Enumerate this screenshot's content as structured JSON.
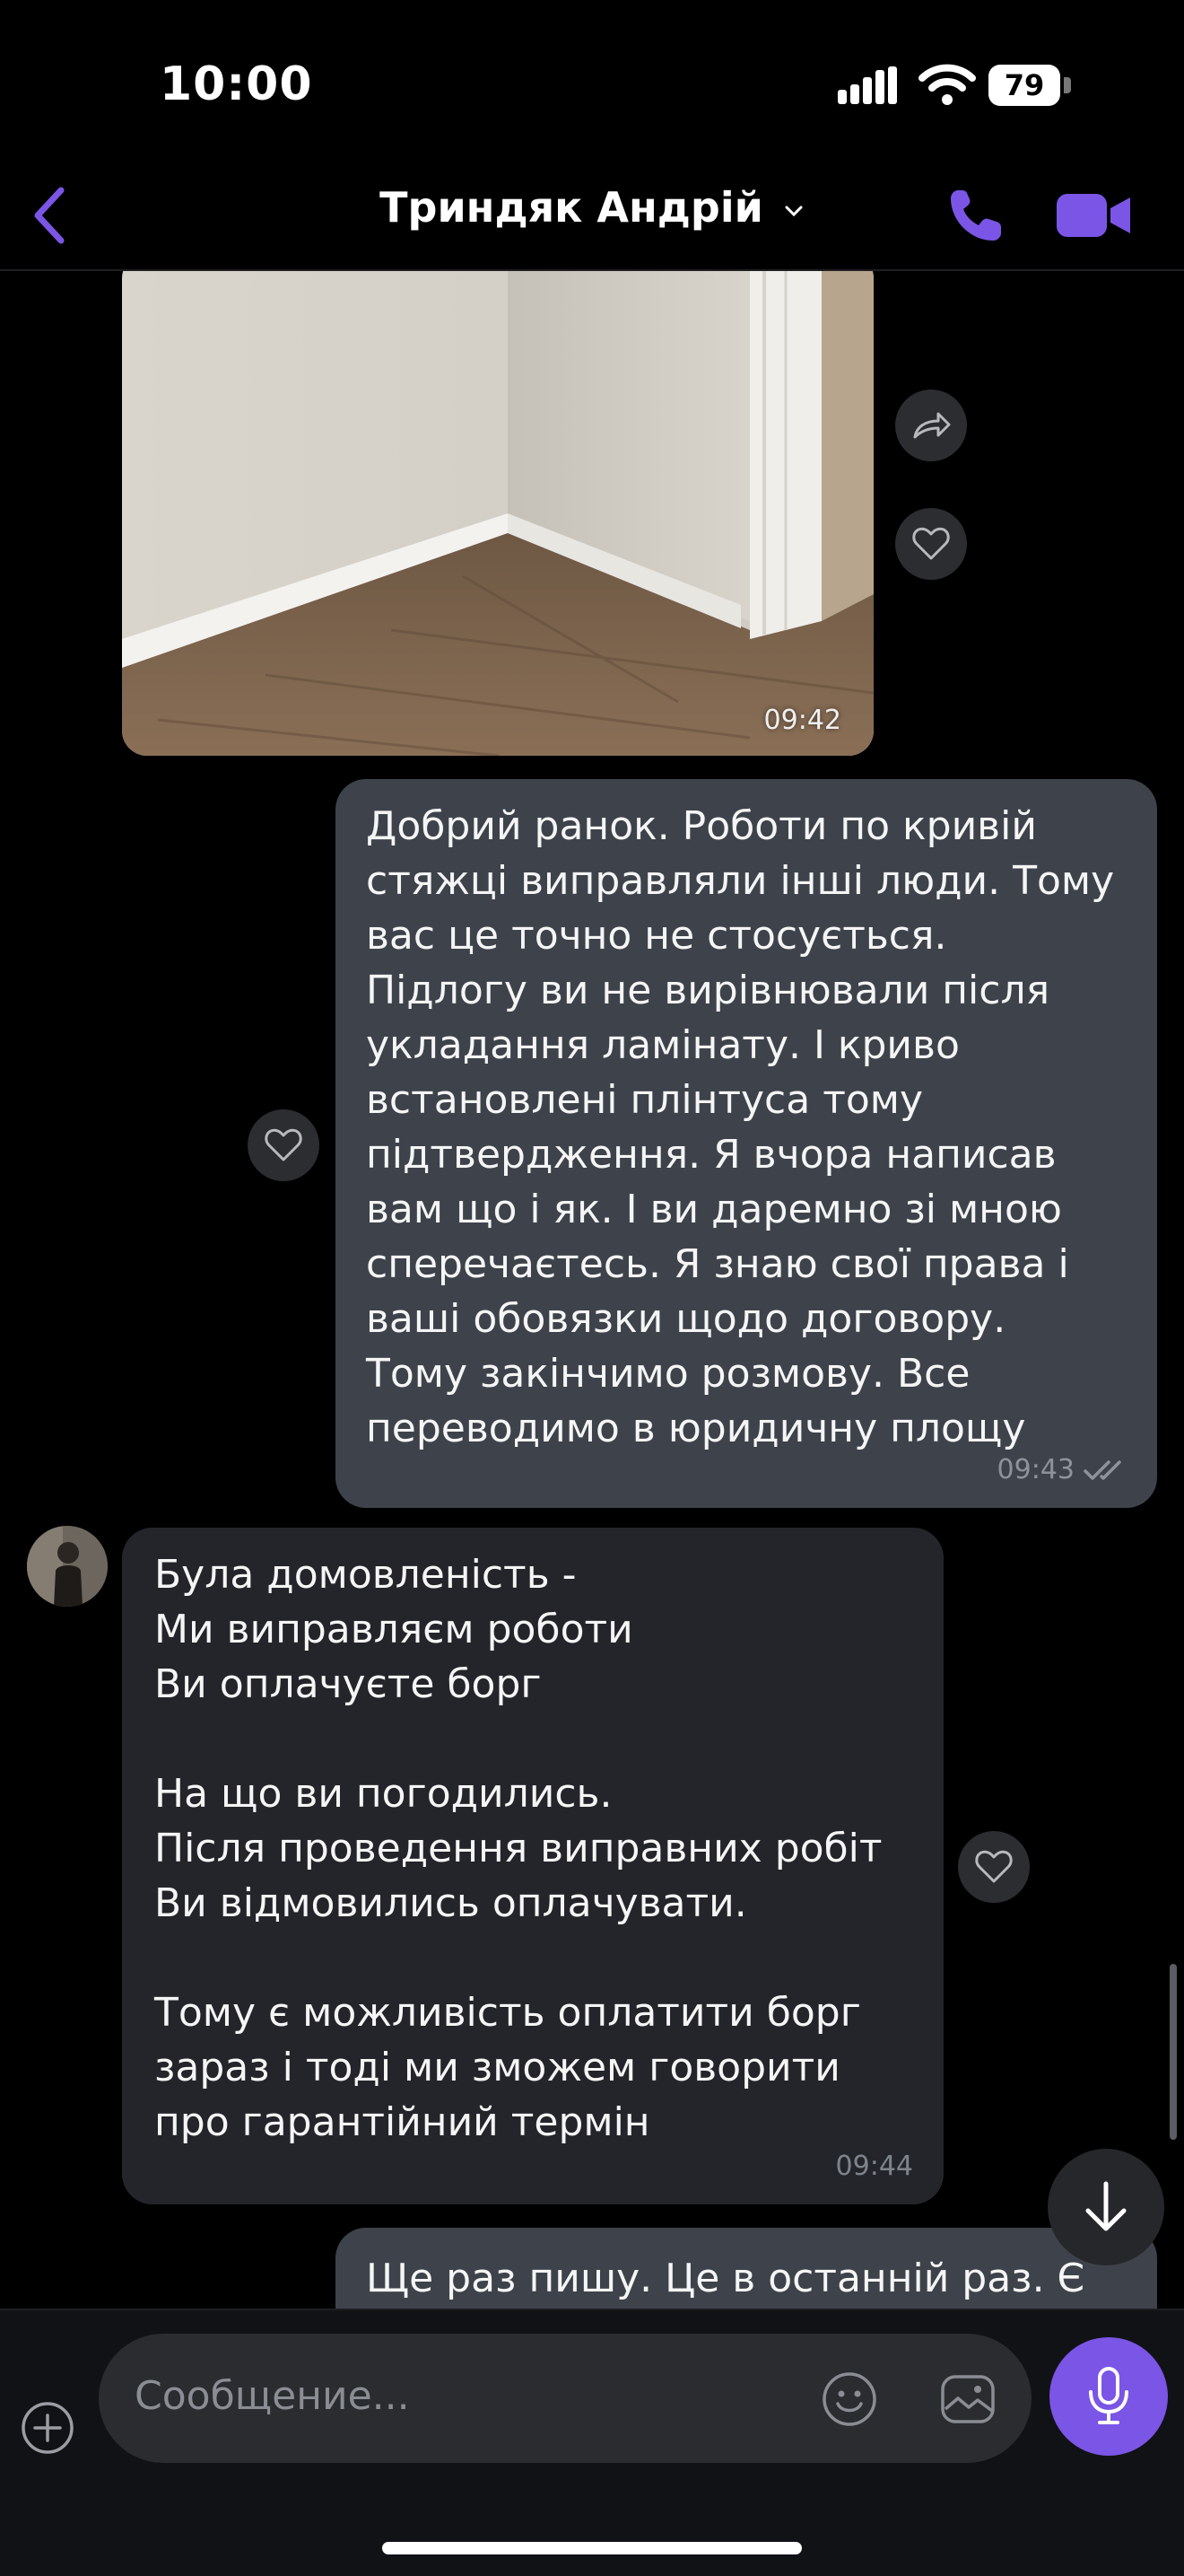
{
  "status_bar": {
    "time": "10:00",
    "battery": "79"
  },
  "header": {
    "contact_name": "Триндяк Андрій"
  },
  "messages": {
    "photo": {
      "time": "09:42"
    },
    "outgoing_1": {
      "lines": [
        "Добрий ранок. Роботи по кривій",
        "стяжці виправляли інші люди. Тому",
        "вас це точно не стосується.",
        "Підлогу ви не вирівнювали після",
        "укладання ламінату. І криво",
        "встановлені плінтуса тому",
        "підтвердження. Я вчора написав",
        "вам що і як. І ви даремно зі мною",
        "сперечаєтесь. Я знаю свої права і",
        "ваші обовязки щодо договору.",
        "Тому закінчимо розмову. Все",
        "переводимо в юридичну площу"
      ],
      "time": "09:43"
    },
    "incoming_1": {
      "lines": [
        "Була домовленість -",
        "Ми виправляєм роботи",
        "Ви оплачуєте борг",
        "",
        "На що ви погодились.",
        "Після проведення виправних робіт",
        "Ви відмовились оплачувати.",
        "",
        "Тому є можливість оплатити борг",
        "зараз і тоді ми зможем говорити",
        "про гарантійний термін"
      ],
      "time": "09:44"
    },
    "outgoing_2": {
      "lines": [
        "Ще раз пишу. Це в останній раз. Є"
      ]
    }
  },
  "input": {
    "placeholder": "Сообщение..."
  },
  "colors": {
    "accent": "#7b55e6",
    "outgoing_bubble": "#3e434b",
    "incoming_bubble": "#23252a"
  }
}
